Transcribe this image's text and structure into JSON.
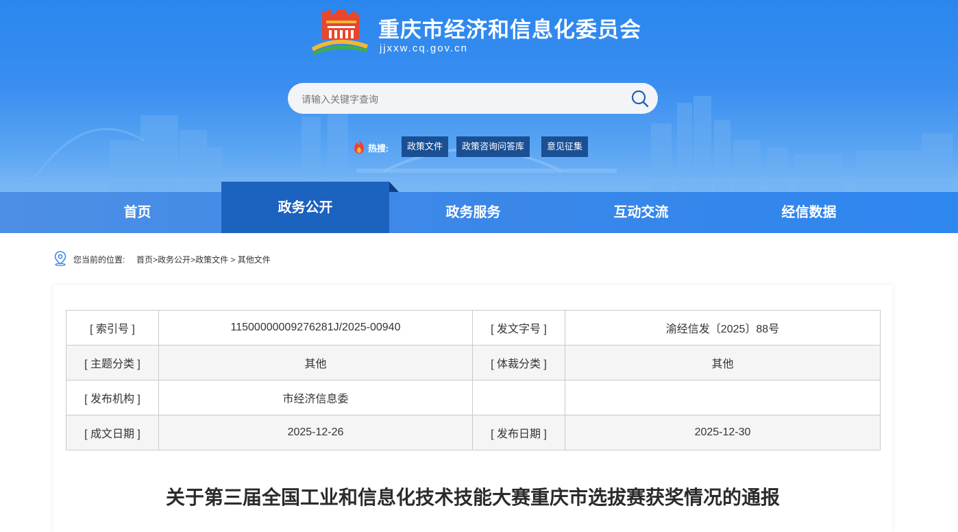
{
  "header": {
    "site_title": "重庆市经济和信息化委员会",
    "site_domain": "jjxxw.cq.gov.cn",
    "search_placeholder": "请输入关键字查询",
    "hot_label": "热搜:",
    "hot_tags": [
      "政策文件",
      "政策咨询问答库",
      "意见征集"
    ]
  },
  "nav": {
    "items": [
      "首页",
      "政务公开",
      "政务服务",
      "互动交流",
      "经信数据"
    ],
    "active": "政务公开"
  },
  "breadcrumb": {
    "label": "您当前的位置:",
    "items": [
      "首页",
      "政务公开",
      "政策文件",
      "其他文件"
    ],
    "separators": [
      ">",
      ">",
      " > "
    ]
  },
  "meta": {
    "rows": [
      [
        "[ 索引号 ]",
        "11500000009276281J/2025-00940",
        "[ 发文字号 ]",
        "渝经信发〔2025〕88号"
      ],
      [
        "[ 主题分类 ]",
        "其他",
        "[ 体裁分类 ]",
        "其他"
      ],
      [
        "[ 发布机构 ]",
        "市经济信息委",
        "",
        ""
      ],
      [
        "[ 成文日期 ]",
        "2025-12-26",
        "[ 发布日期 ]",
        "2025-12-30"
      ]
    ]
  },
  "document": {
    "title": "关于第三届全国工业和信息化技术技能大赛重庆市选拔赛获奖情况的通报"
  },
  "colors": {
    "header_blue": "#2a86ee",
    "nav_blue": "#3b87e8",
    "nav_active": "#1c62bf",
    "hot_tag_bg": "#1a4f94"
  },
  "icons": {
    "logo": "building-emblem-icon",
    "search": "search-icon",
    "hot": "flame-icon",
    "location": "location-pin-icon"
  }
}
